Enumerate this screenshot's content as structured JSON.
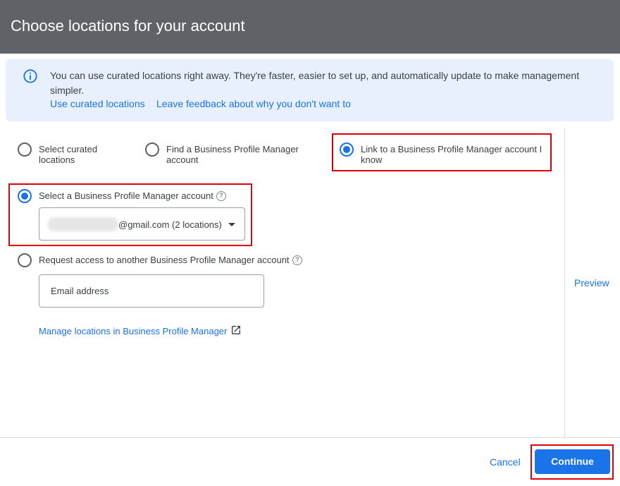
{
  "header": {
    "title": "Choose locations for your account"
  },
  "banner": {
    "icon": "info-icon",
    "text": "You can use curated locations right away. They're faster, easier to set up, and automatically update to make management simpler.",
    "link_curated": "Use curated locations",
    "link_feedback": "Leave feedback about why you don't want to"
  },
  "options": {
    "curated_label": "Select curated locations",
    "find_label": "Find a Business Profile Manager account",
    "link_label": "Link to a Business Profile Manager account I know",
    "selected": "link"
  },
  "account_choice": {
    "select_label": "Select a Business Profile Manager account",
    "select_value": "@gmail.com (2 locations)",
    "request_label": "Request access to another Business Profile Manager account",
    "email_placeholder": "Email address",
    "selected": "select"
  },
  "manage_link": "Manage locations in Business Profile Manager",
  "preview": "Preview",
  "footer": {
    "cancel": "Cancel",
    "continue": "Continue"
  },
  "colors": {
    "accent": "#1a73e8",
    "header_bg": "#5f6368",
    "highlight_box": "#e0000a",
    "banner_bg": "#e8f0fe"
  }
}
